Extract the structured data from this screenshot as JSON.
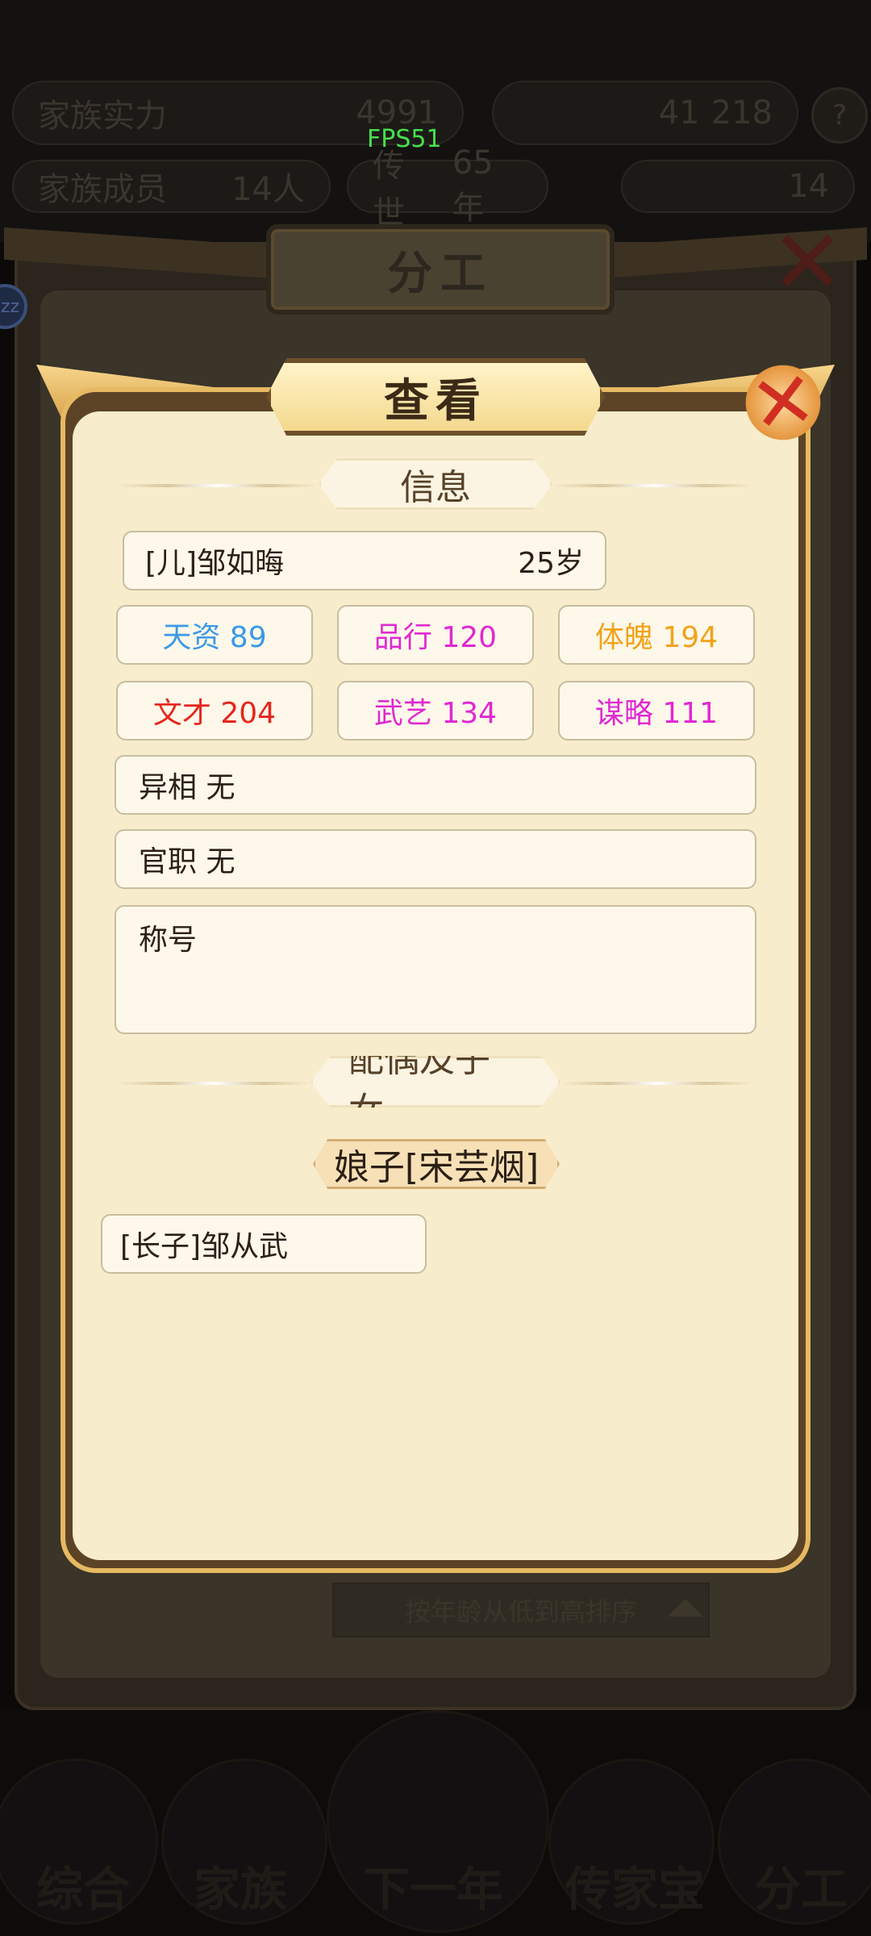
{
  "fps": "FPS51",
  "background": {
    "hud": {
      "clan_power_label": "家族实力",
      "clan_power_value": "4991",
      "resource_value": "41",
      "resource_value2": "218",
      "members_label": "家族成员",
      "members_value": "14人",
      "lineage_label": "传世",
      "lineage_value": "65年",
      "coins_value": "14"
    },
    "panel_title": "分工",
    "sort_button": "按年龄从低到高排序",
    "nav": [
      "综合",
      "家族",
      "下一年",
      "传家宝",
      "分工"
    ]
  },
  "dialog": {
    "title": "查看",
    "info_header": "信息",
    "name": "[儿]邹如晦",
    "age": "25岁",
    "stats": [
      {
        "label": "天资 89",
        "color": "#3b99e6"
      },
      {
        "label": "品行 120",
        "color": "#e028d2"
      },
      {
        "label": "体魄 194",
        "color": "#f2a21b"
      },
      {
        "label": "文才 204",
        "color": "#e6261e"
      },
      {
        "label": "武艺 134",
        "color": "#e028d2"
      },
      {
        "label": "谋略 111",
        "color": "#e028d2"
      }
    ],
    "trait": "异相 无",
    "office": "官职 无",
    "title_field": "称号",
    "family_header": "配偶及子女",
    "spouse": "娘子[宋芸烟]",
    "children": [
      "[长子]邹从武"
    ]
  }
}
